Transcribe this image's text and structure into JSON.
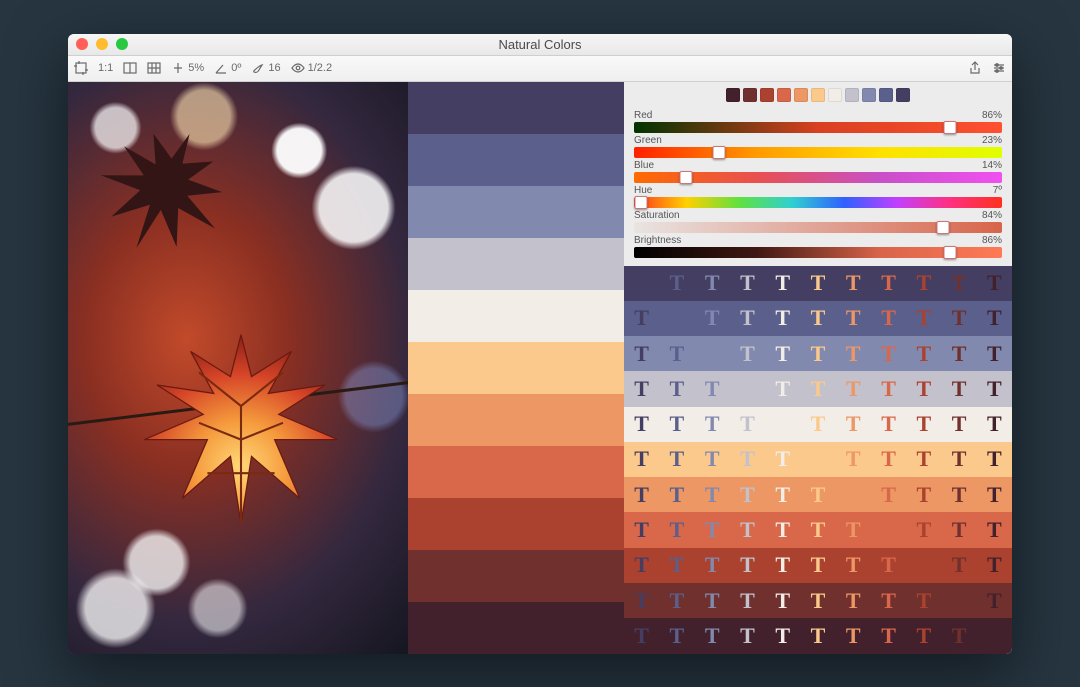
{
  "window": {
    "title": "Natural Colors"
  },
  "toolbar": {
    "fit_label": "1:1",
    "tolerance": "5%",
    "angle": "0º",
    "sample": "16",
    "gamma": "1/2.2"
  },
  "palette": [
    "#443f62",
    "#5a5f8b",
    "#8289af",
    "#c3c1cc",
    "#f2ede6",
    "#fbc98b",
    "#ec9764",
    "#d9684a",
    "#ab422f",
    "#70312e",
    "#43212c"
  ],
  "swatches": [
    "#43212c",
    "#70312e",
    "#ab422f",
    "#d9684a",
    "#ec9764",
    "#fbc98b",
    "#f2ede6",
    "#c3c1cc",
    "#8289af",
    "#5a5f8b",
    "#443f62"
  ],
  "sliders": [
    {
      "label": "Red",
      "value": "86%",
      "pct": 86,
      "grad": "grad-red"
    },
    {
      "label": "Green",
      "value": "23%",
      "pct": 23,
      "grad": "grad-green"
    },
    {
      "label": "Blue",
      "value": "14%",
      "pct": 14,
      "grad": "grad-blue"
    },
    {
      "label": "Hue",
      "value": "7º",
      "pct": 2,
      "grad": "grad-hue"
    },
    {
      "label": "Saturation",
      "value": "84%",
      "pct": 84,
      "grad": "grad-sat"
    },
    {
      "label": "Brightness",
      "value": "86%",
      "pct": 86,
      "grad": "grad-bri"
    }
  ],
  "typo_glyph": "T"
}
